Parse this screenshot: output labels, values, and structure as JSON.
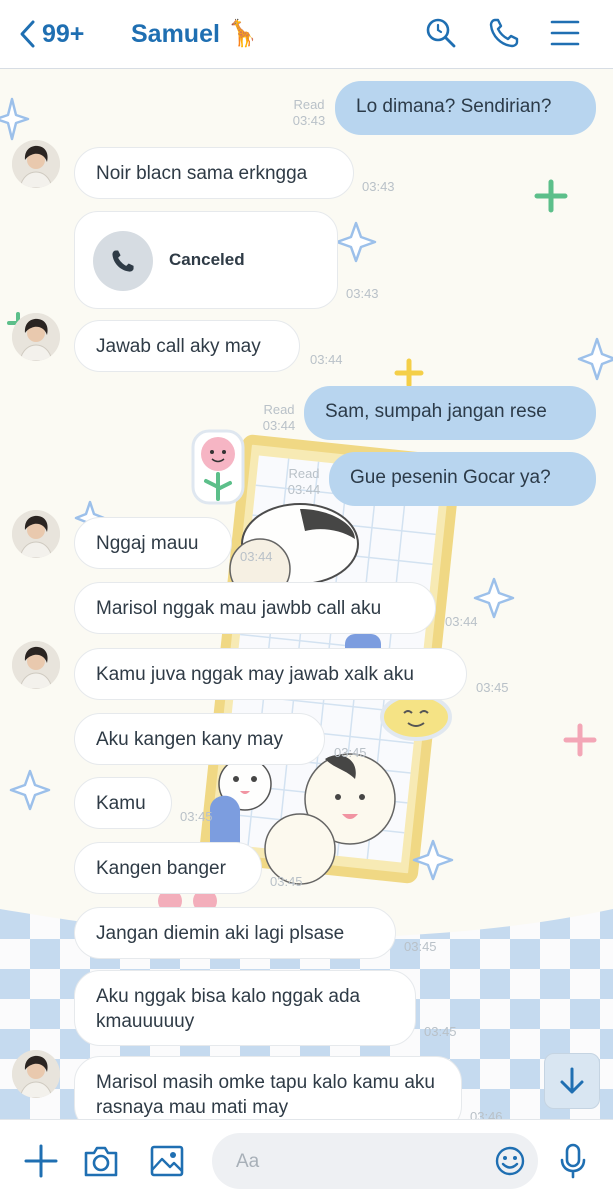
{
  "header": {
    "unread_count": "99+",
    "contact_name": "Samuel",
    "contact_emoji": "🦒",
    "icons": [
      "back-chevron-icon",
      "search-icon",
      "phone-icon",
      "menu-icon"
    ]
  },
  "messages": [
    {
      "side": "out",
      "text": "Lo dimana? Sendirian?",
      "read": "Read",
      "time": "03:43"
    },
    {
      "side": "in",
      "text": "Noir blacn sama erkngga",
      "time": "03:43",
      "avatar": true
    },
    {
      "side": "in",
      "type": "call",
      "text": "Canceled",
      "time": "03:43"
    },
    {
      "side": "in",
      "text": "Jawab call aky may",
      "time": "03:44",
      "avatar": true
    },
    {
      "side": "out",
      "text": "Sam, sumpah jangan rese",
      "read": "Read",
      "time": "03:44"
    },
    {
      "side": "out",
      "text": "Gue pesenin Gocar ya?",
      "read": "Read",
      "time": "03:44"
    },
    {
      "side": "in",
      "text": "Nggaj mauu",
      "time": "03:44",
      "avatar": true
    },
    {
      "side": "in",
      "text": "Marisol nggak mau jawbb call aku",
      "time": "03:44"
    },
    {
      "side": "in",
      "text": "Kamu juva nggak may jawab xalk aku",
      "time": "03:45",
      "avatar": true
    },
    {
      "side": "in",
      "text": "Aku kangen kany may",
      "time": "03:45"
    },
    {
      "side": "in",
      "text": "Kamu",
      "time": "03:45"
    },
    {
      "side": "in",
      "text": "Kangen banger",
      "time": "03:45"
    },
    {
      "side": "in",
      "text": "Jangan diemin aki lagi plsase",
      "time": "03:45"
    },
    {
      "side": "in",
      "text": "Aku nggak bisa kalo nggak ada kmauuuuuy",
      "time": "03:45"
    },
    {
      "side": "in",
      "text": "Marisol masih omke tapu kalo kamu aku rasnaya mau mati may",
      "time": "03:46",
      "avatar": true
    }
  ],
  "composer": {
    "placeholder": "Aa",
    "icons": [
      "plus-icon",
      "camera-icon",
      "image-icon",
      "emoji-icon",
      "microphone-icon"
    ]
  },
  "scroll_down_icon": "arrow-down-icon",
  "colors": {
    "accent": "#1f6fb2",
    "outgoing_bubble": "#b8d5ef",
    "incoming_bubble": "#ffffff",
    "background": "#fbfaf3",
    "checker_blue": "#bcd4ee"
  }
}
